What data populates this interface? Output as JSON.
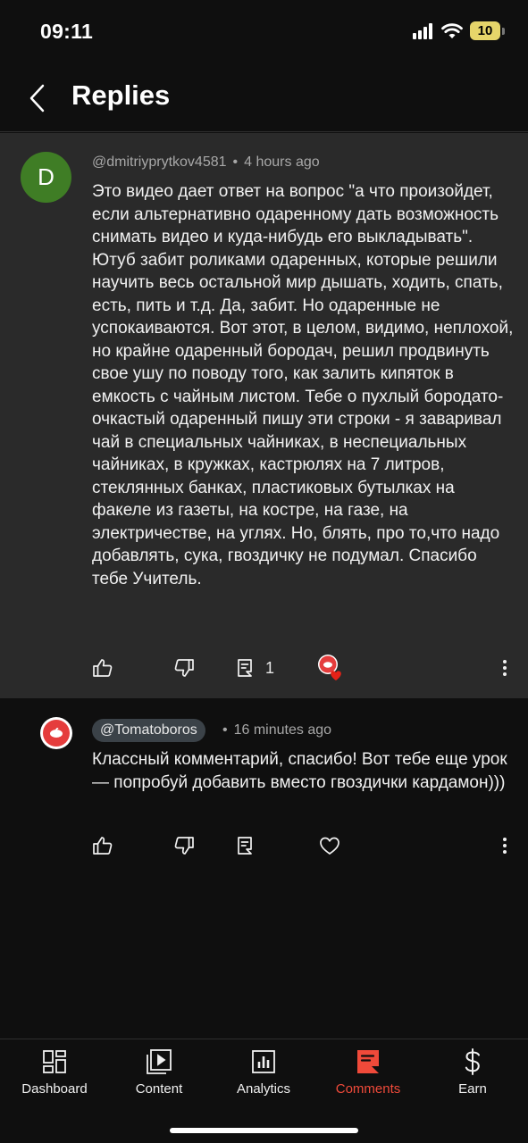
{
  "status_bar": {
    "time": "09:11",
    "battery": "10"
  },
  "header": {
    "title": "Replies"
  },
  "parent_comment": {
    "avatar_letter": "D",
    "author": "@dmitriyprytkov4581",
    "time": "4 hours ago",
    "text": "Это видео дает ответ на вопрос \"а что произойдет, если альтернативно одаренному дать возможность снимать видео и куда-нибудь его выкладывать\". Ютуб забит роликами одаренных, которые решили научить весь остальной мир дышать, ходить, спать, есть, пить и т.д. Да, забит. Но одаренные не успокаиваются. Вот этот, в целом, видимо, неплохой, но крайне одаренный бородач, решил продвинуть свое ушу по поводу того, как залить кипяток в емкость с чайным листом. Тебе  о пухлый бородато-очкастый одаренный пишу эти строки - я заваривал чай в специальных чайниках, в неспециальных чайниках, в кружках, кастрюлях на 7 литров, стеклянных банках, пластиковых бутылках на факеле из газеты, на костре, на газе, на электричестве, на углях. Но, блять, про то,что надо добавлять, сука, гвоздичку не подумал. Спасибо тебе Учитель.",
    "reply_count": "1"
  },
  "reply": {
    "author": "@Tomatoboros",
    "time": "16 minutes ago",
    "text": "Классный комментарий, спасибо! Вот тебе еще урок — попробуй добавить вместо гвоздички кардамон)))"
  },
  "nav": {
    "items": [
      {
        "label": "Dashboard",
        "icon": "dashboard-icon"
      },
      {
        "label": "Content",
        "icon": "content-icon"
      },
      {
        "label": "Analytics",
        "icon": "analytics-icon"
      },
      {
        "label": "Comments",
        "icon": "comments-icon",
        "active": true
      },
      {
        "label": "Earn",
        "icon": "dollar-icon"
      }
    ]
  },
  "colors": {
    "accent": "#f04a3a",
    "avatar_d": "#3f7d25",
    "heart": "#e62117"
  }
}
